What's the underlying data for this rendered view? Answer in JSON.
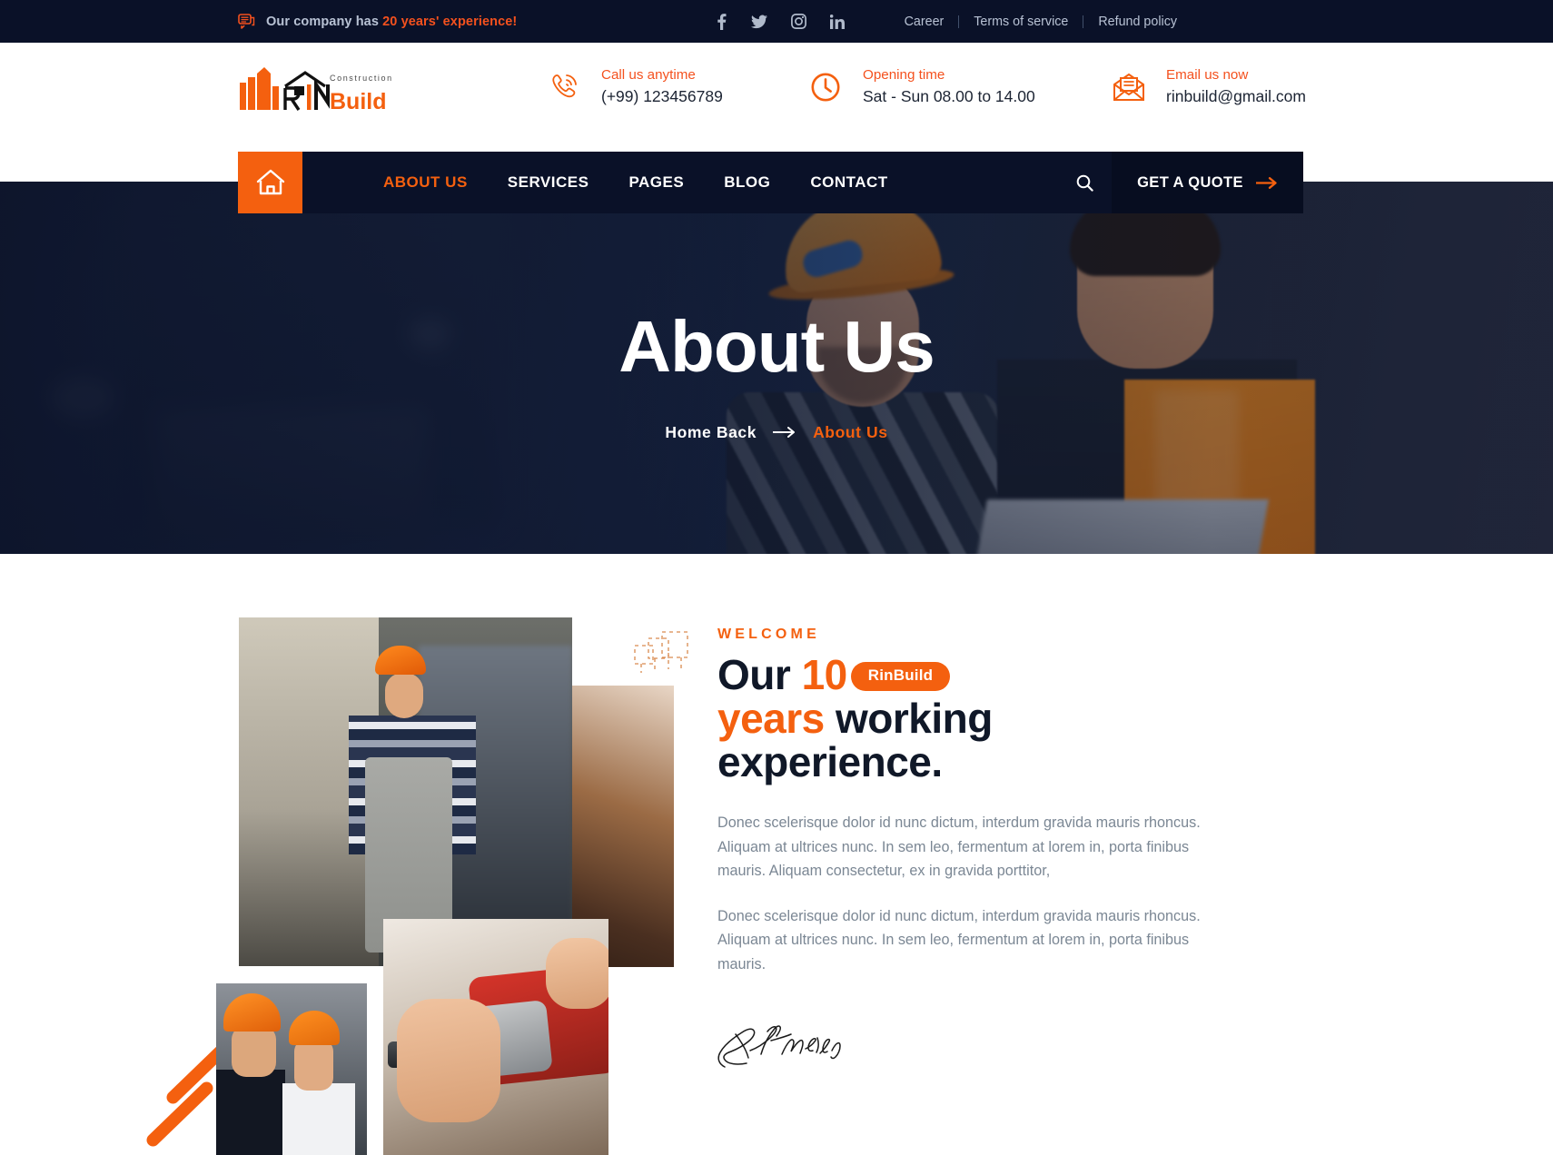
{
  "topbar": {
    "icon": "chat-bubble-icon",
    "message_prefix": "Our company has ",
    "message_highlight": "20 years' experience!",
    "social": [
      {
        "name": "facebook-icon",
        "label": "Facebook"
      },
      {
        "name": "twitter-icon",
        "label": "Twitter"
      },
      {
        "name": "instagram-icon",
        "label": "Instagram"
      },
      {
        "name": "linkedin-icon",
        "label": "LinkedIn"
      }
    ],
    "links": [
      "Career",
      "Terms of service",
      "Refund policy"
    ]
  },
  "header": {
    "logo": {
      "mark": "rn-building-icon",
      "sup": "Construction",
      "main": "RinBuild"
    },
    "info": [
      {
        "icon": "phone-ring-icon",
        "label": "Call us anytime",
        "value": "(+99) 123456789"
      },
      {
        "icon": "clock-icon",
        "label": "Opening time",
        "value": "Sat - Sun 08.00 to 14.00"
      },
      {
        "icon": "envelope-icon",
        "label": "Email us now",
        "value": "rinbuild@gmail.com"
      }
    ]
  },
  "nav": {
    "home_icon": "home-icon",
    "items": [
      {
        "label": "ABOUT US",
        "active": true
      },
      {
        "label": "SERVICES",
        "active": false
      },
      {
        "label": "PAGES",
        "active": false
      },
      {
        "label": "BLOG",
        "active": false
      },
      {
        "label": "CONTACT",
        "active": false
      }
    ],
    "search_icon": "search-icon",
    "quote_label": "GET A QUOTE",
    "quote_arrow_icon": "arrow-right-icon"
  },
  "hero": {
    "title": "About Us",
    "breadcrumb_home": "Home Back",
    "breadcrumb_arrow_icon": "arrow-right-icon",
    "breadcrumb_current": "About Us"
  },
  "about": {
    "eyebrow": "WELCOME",
    "headline_1": "Our ",
    "headline_num": "10",
    "headline_pill": "RinBuild",
    "headline_2": "years",
    "headline_3": " working",
    "headline_4": "experience.",
    "paragraph_1": "Donec scelerisque dolor id nunc dictum, interdum gravida mauris rhoncus. Aliquam at ultrices nunc. In sem leo, fermentum at lorem in, porta finibus mauris. Aliquam consectetur, ex in gravida porttitor,",
    "paragraph_2": "Donec scelerisque dolor id nunc dictum, interdum gravida mauris rhoncus. Aliquam at ultrices nunc. In sem leo, fermentum at lorem in, porta finibus mauris.",
    "signature_name": "B. Franklin",
    "images": [
      {
        "name": "worker-in-factory-photo"
      },
      {
        "name": "wood-texture-photo"
      },
      {
        "name": "two-engineers-photo"
      },
      {
        "name": "hand-with-drill-photo"
      }
    ]
  },
  "colors": {
    "accent": "#f4600f",
    "accent_soft": "#f4511e",
    "dark": "#0a1128",
    "dark_deep": "#070d20",
    "text": "#101828",
    "muted": "#7b8794"
  }
}
